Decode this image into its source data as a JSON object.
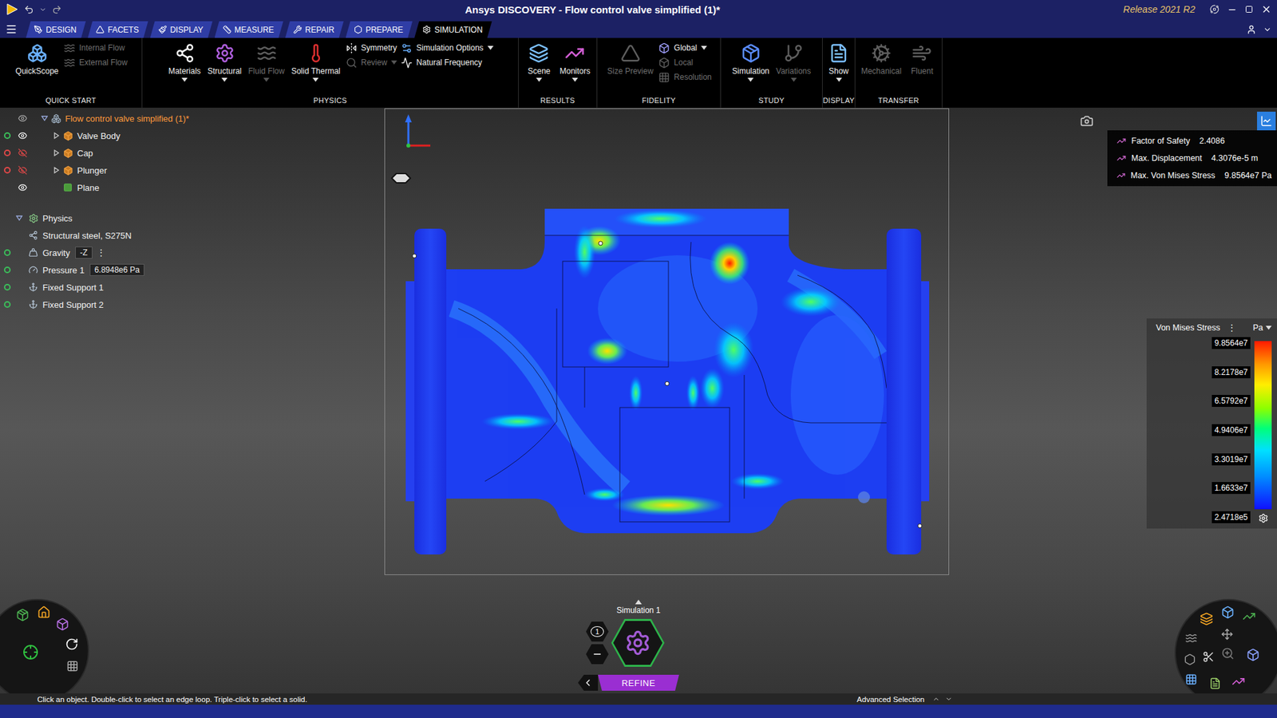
{
  "window": {
    "title": "Ansys DISCOVERY - Flow control valve simplified (1)*",
    "release": "Release 2021 R2"
  },
  "tabs": [
    {
      "label": "DESIGN",
      "selected": false
    },
    {
      "label": "FACETS",
      "selected": false
    },
    {
      "label": "DISPLAY",
      "selected": false
    },
    {
      "label": "MEASURE",
      "selected": false
    },
    {
      "label": "REPAIR",
      "selected": false
    },
    {
      "label": "PREPARE",
      "selected": false
    },
    {
      "label": "SIMULATION",
      "selected": true
    }
  ],
  "ribbon": {
    "groups": [
      {
        "label": "QUICK START",
        "columns": [
          {
            "kind": "large",
            "items": [
              {
                "label": "QuickScope",
                "enabled": true,
                "dropdown": false
              }
            ]
          },
          {
            "kind": "stack",
            "items": [
              {
                "label": "Internal Flow",
                "enabled": false,
                "dropdown": false
              },
              {
                "label": "External Flow",
                "enabled": false,
                "dropdown": false
              }
            ]
          }
        ]
      },
      {
        "label": "PHYSICS",
        "columns": [
          {
            "kind": "large",
            "items": [
              {
                "label": "Materials",
                "enabled": true,
                "dropdown": true
              }
            ]
          },
          {
            "kind": "large",
            "items": [
              {
                "label": "Structural",
                "enabled": true,
                "dropdown": true
              }
            ]
          },
          {
            "kind": "large",
            "items": [
              {
                "label": "Fluid Flow",
                "enabled": false,
                "dropdown": true
              }
            ]
          },
          {
            "kind": "large",
            "items": [
              {
                "label": "Solid Thermal",
                "enabled": true,
                "dropdown": true
              }
            ]
          },
          {
            "kind": "stack",
            "items": [
              {
                "label": "Symmetry",
                "enabled": true,
                "dropdown": false
              },
              {
                "label": "Review",
                "enabled": false,
                "dropdown": true
              }
            ]
          },
          {
            "kind": "stack",
            "items": [
              {
                "label": "Simulation Options",
                "enabled": true,
                "dropdown": true
              },
              {
                "label": "Natural Frequency",
                "enabled": true,
                "dropdown": false
              }
            ]
          }
        ]
      },
      {
        "label": "RESULTS",
        "columns": [
          {
            "kind": "large",
            "items": [
              {
                "label": "Scene",
                "enabled": true,
                "dropdown": true
              }
            ]
          },
          {
            "kind": "large",
            "items": [
              {
                "label": "Monitors",
                "enabled": true,
                "dropdown": true
              }
            ]
          }
        ]
      },
      {
        "label": "FIDELITY",
        "columns": [
          {
            "kind": "large",
            "items": [
              {
                "label": "Size Preview",
                "enabled": false,
                "dropdown": false
              }
            ]
          },
          {
            "kind": "stack",
            "items": [
              {
                "label": "Global",
                "enabled": true,
                "dropdown": true
              },
              {
                "label": "Local",
                "enabled": false,
                "dropdown": false
              },
              {
                "label": "Resolution",
                "enabled": false,
                "dropdown": false
              }
            ]
          }
        ]
      },
      {
        "label": "STUDY",
        "columns": [
          {
            "kind": "large",
            "items": [
              {
                "label": "Simulation",
                "enabled": true,
                "dropdown": true
              }
            ]
          },
          {
            "kind": "large",
            "items": [
              {
                "label": "Variations",
                "enabled": false,
                "dropdown": true
              }
            ]
          }
        ]
      },
      {
        "label": "DISPLAY",
        "columns": [
          {
            "kind": "large",
            "items": [
              {
                "label": "Show",
                "enabled": true,
                "dropdown": true
              }
            ]
          }
        ]
      },
      {
        "label": "TRANSFER",
        "columns": [
          {
            "kind": "large",
            "items": [
              {
                "label": "Mechanical",
                "enabled": false,
                "dropdown": false
              }
            ]
          },
          {
            "kind": "large",
            "items": [
              {
                "label": "Fluent",
                "enabled": false,
                "dropdown": false
              }
            ]
          }
        ]
      }
    ]
  },
  "structure_tree": {
    "root": {
      "label": "Flow control valve simplified (1)*",
      "expanded": true,
      "selected": true
    },
    "items": [
      {
        "label": "Valve Body",
        "kind": "part",
        "visible": true,
        "expanded": false,
        "active": true
      },
      {
        "label": "Cap",
        "kind": "part",
        "visible": false,
        "expanded": false,
        "active": false
      },
      {
        "label": "Plunger",
        "kind": "part",
        "visible": false,
        "expanded": false,
        "active": false
      },
      {
        "label": "Plane",
        "kind": "plane",
        "visible": true
      }
    ]
  },
  "physics_tree": {
    "label": "Physics",
    "expanded": true,
    "items": [
      {
        "label": "Structural steel, S275N",
        "kind": "material"
      },
      {
        "label": "Gravity",
        "kind": "gravity",
        "active": true,
        "value": "-Z",
        "menu": "⋮"
      },
      {
        "label": "Pressure 1",
        "kind": "pressure",
        "active": true,
        "value": "6.8948e6 Pa"
      },
      {
        "label": "Fixed Support 1",
        "kind": "support",
        "active": true
      },
      {
        "label": "Fixed Support 2",
        "kind": "support",
        "active": true
      }
    ]
  },
  "results": [
    {
      "label": "Factor of Safety",
      "value": "2.4086"
    },
    {
      "label": "Max. Displacement",
      "value": "4.3076e-5 m"
    },
    {
      "label": "Max. Von Mises Stress",
      "value": "9.8564e7 Pa"
    }
  ],
  "legend": {
    "title": "Von Mises Stress",
    "menu": "⋮",
    "unit": "Pa",
    "ticks": [
      "9.8564e7",
      "8.2178e7",
      "6.5792e7",
      "4.9406e7",
      "3.3019e7",
      "1.6633e7",
      "2.4718e5"
    ]
  },
  "simulation": {
    "label": "Simulation 1",
    "count": "1",
    "stage": "REFINE"
  },
  "status_bar": {
    "hint": "Click an object. Double-click to select an edge loop. Triple-click to select a solid.",
    "mode": "Advanced Selection"
  }
}
